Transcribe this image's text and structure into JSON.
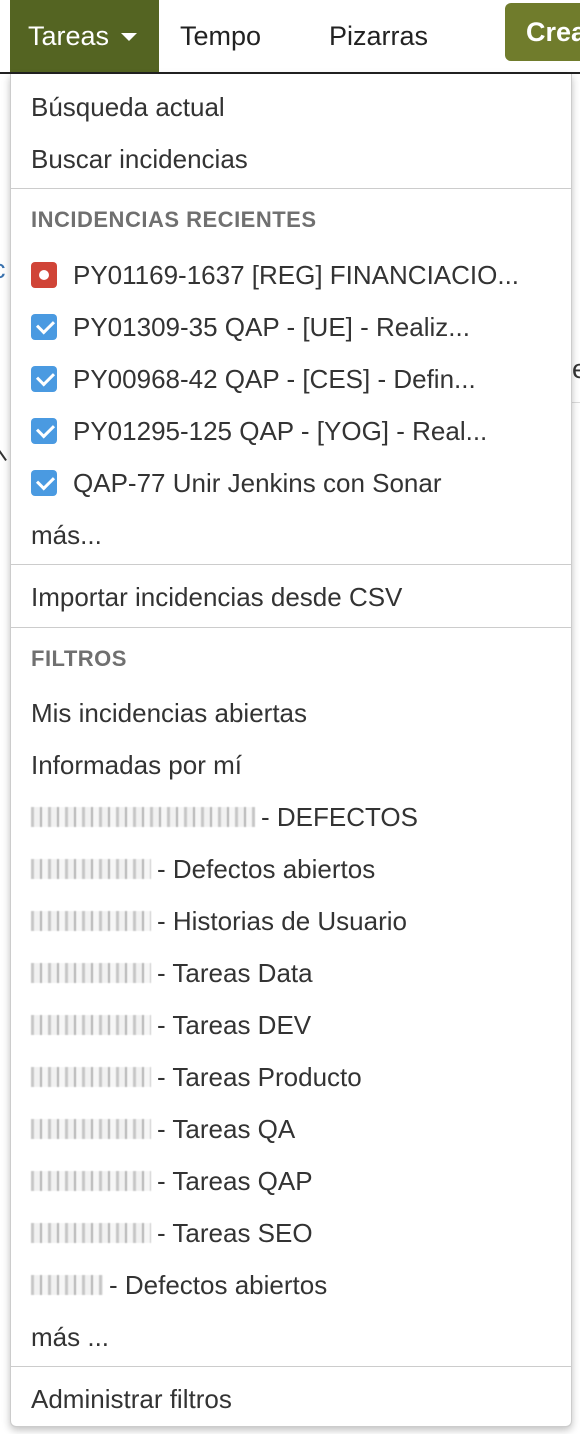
{
  "topnav": {
    "active_tab": "Tareas",
    "tabs": [
      "Tempo",
      "Pizarras"
    ],
    "create_button": "Crea"
  },
  "background": {
    "left_fragment": "c",
    "right_fragment": "e"
  },
  "dropdown": {
    "links_top": [
      "Búsqueda actual",
      "Buscar incidencias"
    ],
    "recent_heading": "INCIDENCIAS RECIENTES",
    "recent_issues": [
      {
        "icon": "bug-icon",
        "text": "PY01169-1637 [REG] FINANCIACIO..."
      },
      {
        "icon": "task-icon",
        "text": "PY01309-35 QAP - [UE] - Realiz..."
      },
      {
        "icon": "task-icon",
        "text": "PY00968-42 QAP - [CES] - Defin..."
      },
      {
        "icon": "task-icon",
        "text": "PY01295-125 QAP - [YOG] - Real..."
      },
      {
        "icon": "task-icon",
        "text": "QAP-77 Unir Jenkins con Sonar"
      }
    ],
    "recent_more": "más...",
    "import_csv": "Importar incidencias desde CSV",
    "filters_heading": "FILTROS",
    "filters": [
      {
        "redacted": false,
        "text": "Mis incidencias abiertas"
      },
      {
        "redacted": false,
        "text": "Informadas por mí"
      },
      {
        "redacted": true,
        "text": "- DEFECTOS"
      },
      {
        "redacted": true,
        "text": "- Defectos abiertos"
      },
      {
        "redacted": true,
        "text": "- Historias de Usuario"
      },
      {
        "redacted": true,
        "text": "- Tareas Data"
      },
      {
        "redacted": true,
        "text": "- Tareas DEV"
      },
      {
        "redacted": true,
        "text": "- Tareas Producto"
      },
      {
        "redacted": true,
        "text": "- Tareas QA"
      },
      {
        "redacted": true,
        "text": "- Tareas QAP"
      },
      {
        "redacted": true,
        "text": "- Tareas SEO"
      },
      {
        "redacted": true,
        "text": "- Defectos abiertos"
      }
    ],
    "filters_more": "más ...",
    "manage_filters": "Administrar filtros"
  },
  "colors": {
    "nav_active": "#546422",
    "create_button": "#707c2c",
    "bug_icon": "#d04437",
    "task_icon": "#4a9ae1",
    "heading_text": "#707070"
  }
}
